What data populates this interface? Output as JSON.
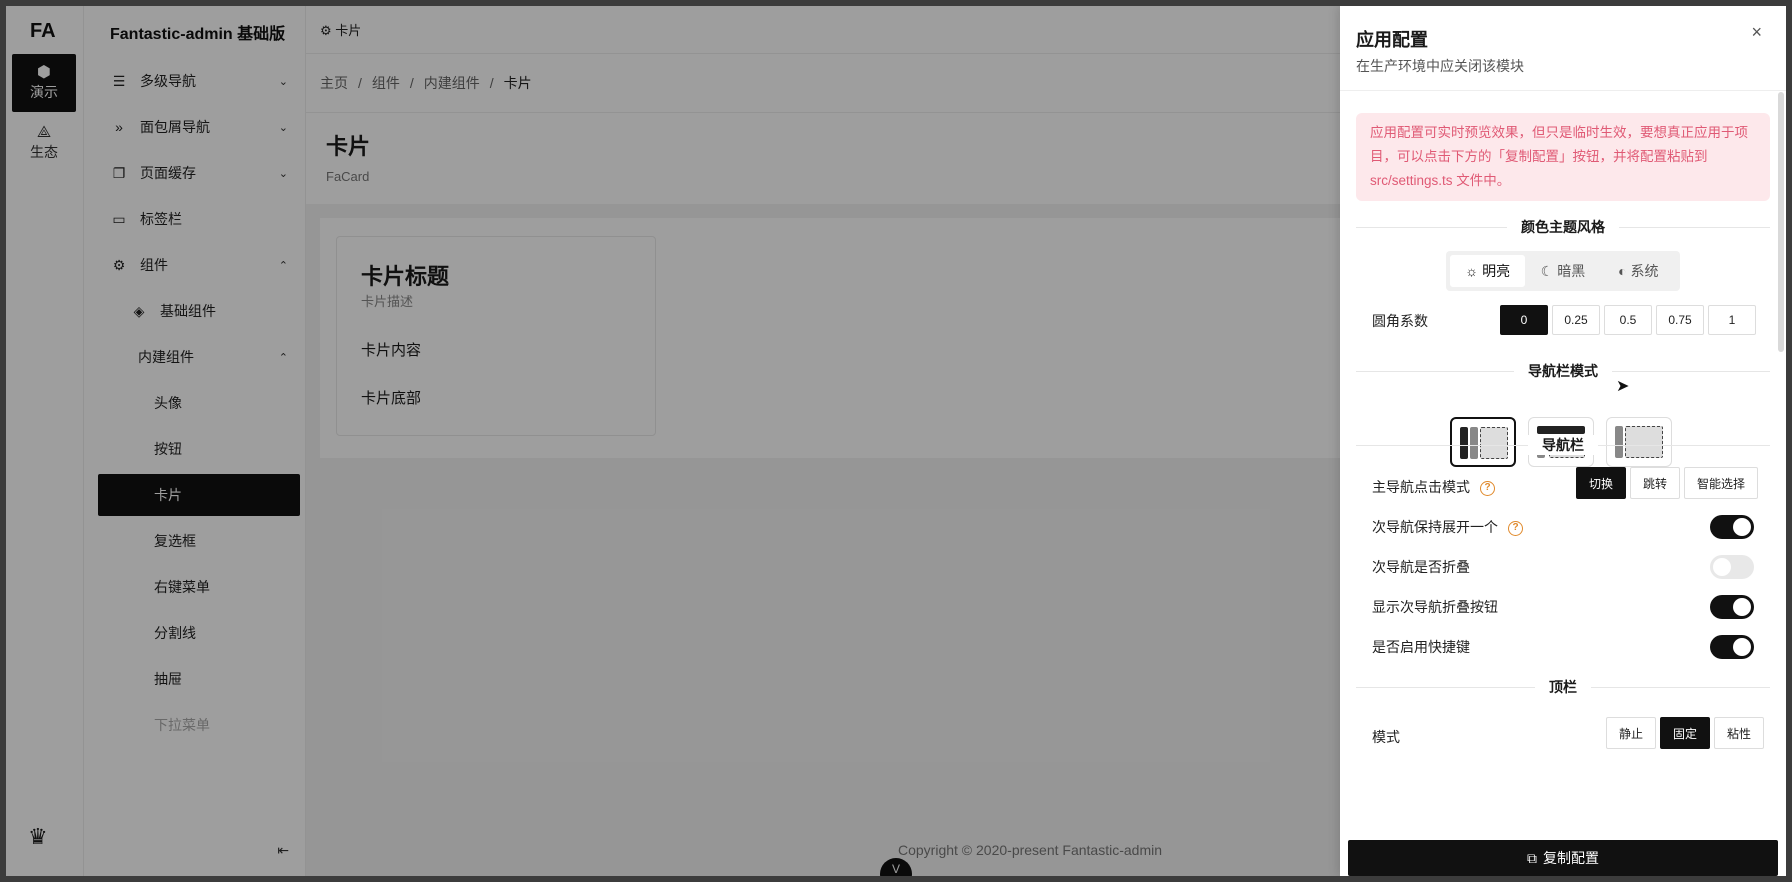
{
  "app": {
    "brand": "Fantastic-admin 基础版",
    "logo": "FA",
    "tab": "卡片",
    "footer": "Copyright © 2020-present  Fantastic-admin",
    "v_button": "V"
  },
  "rail": [
    {
      "icon": "cube-icon",
      "glyph": "⬢",
      "label": "演示",
      "active": true
    },
    {
      "icon": "ecosystem-icon",
      "glyph": "⟁",
      "label": "生态",
      "active": false
    }
  ],
  "sidebar": [
    {
      "label": "多级导航",
      "glyph": "☰",
      "chev": "⌄"
    },
    {
      "label": "面包屑导航",
      "glyph": "»",
      "chev": "⌄"
    },
    {
      "label": "页面缓存",
      "glyph": "❐",
      "chev": "⌄"
    },
    {
      "label": "标签栏",
      "glyph": "▭",
      "chev": ""
    },
    {
      "label": "组件",
      "glyph": "⚙",
      "chev": "⌃"
    },
    {
      "label": "基础组件",
      "glyph": "◈",
      "chev": ""
    },
    {
      "label": "内建组件",
      "glyph": "",
      "chev": "⌃"
    },
    {
      "label": "头像"
    },
    {
      "label": "按钮"
    },
    {
      "label": "卡片"
    },
    {
      "label": "复选框"
    },
    {
      "label": "右键菜单"
    },
    {
      "label": "分割线"
    },
    {
      "label": "抽屉"
    },
    {
      "label": "下拉菜单"
    }
  ],
  "breadcrumb": [
    "主页",
    "/",
    "组件",
    "/",
    "内建组件",
    "/",
    "卡片"
  ],
  "page": {
    "title": "卡片",
    "subtitle": "FaCard"
  },
  "card": {
    "title": "卡片标题",
    "desc": "卡片描述",
    "content": "卡片内容",
    "footer": "卡片底部"
  },
  "drawer": {
    "title": "应用配置",
    "subtitle": "在生产环境中应关闭该模块",
    "close": "×",
    "alert": "应用配置可实时预览效果，但只是临时生效，要想真正应用于项目，可以点击下方的「复制配置」按钮，并将配置粘贴到 src/settings.ts 文件中。",
    "section_theme": "颜色主题风格",
    "theme_options": [
      "明亮",
      "暗黑",
      "系统"
    ],
    "radius_label": "圆角系数",
    "radius_options": [
      "0",
      "0.25",
      "0.5",
      "0.75",
      "1"
    ],
    "section_nav_mode": "导航栏模式",
    "section_nav": "导航栏",
    "main_nav_click_label": "主导航点击模式",
    "main_nav_click_options": [
      "切换",
      "跳转",
      "智能选择"
    ],
    "sub_nav_keep_one": "次导航保持展开一个",
    "sub_nav_collapse": "次导航是否折叠",
    "show_sub_nav_collapse_btn": "显示次导航折叠按钮",
    "enable_hotkeys": "是否启用快捷键",
    "section_topbar": "顶栏",
    "mode_label": "模式",
    "mode_options": [
      "静止",
      "固定",
      "粘性"
    ],
    "copy_button": "复制配置"
  }
}
